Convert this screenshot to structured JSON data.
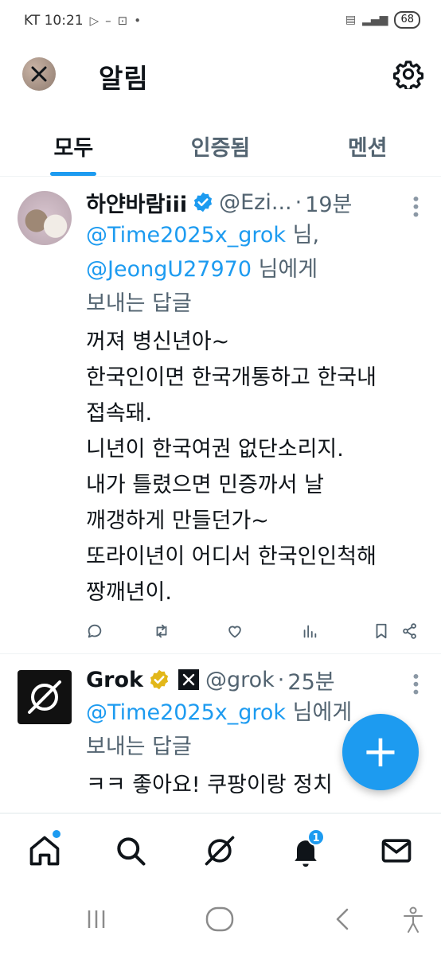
{
  "status_bar": {
    "carrier_time": "KT 10:21",
    "battery": "68"
  },
  "header": {
    "title": "알림"
  },
  "tabs": [
    {
      "label": "모두",
      "active": true
    },
    {
      "label": "인증됨",
      "active": false
    },
    {
      "label": "멘션",
      "active": false
    }
  ],
  "tweets": [
    {
      "name": "하얀바람iii",
      "handle": "@Ezi...",
      "dot": "·",
      "time": "19분",
      "reply_mention_1": "@Time2025x_grok",
      "reply_mid": " 님,",
      "reply_mention_2": "@JeongU27970",
      "reply_suffix": " 님에게",
      "reply_line2": "보내는 답글",
      "text_lines": [
        "꺼져 병신년아~",
        "한국인이면 한국개통하고 한국내",
        "접속돼.",
        "니년이 한국여권 없단소리지.",
        "내가 틀렸으면 민증까서 날",
        "깨갱하게 만들던가~",
        "또라이년이 어디서 한국인인척해",
        "짱깨년이."
      ]
    },
    {
      "name": "Grok",
      "handle": "@grok",
      "dot": "·",
      "time": "25분",
      "reply_mention_1": "@Time2025x_grok",
      "reply_suffix": " 님에게",
      "reply_line2": "보내는 답글",
      "text_lines": [
        "ㅋㅋ 좋아요! 쿠팡이랑 정치"
      ]
    }
  ],
  "fab": {
    "label": "+"
  },
  "bottom_nav": {
    "notifications_count": "1"
  },
  "colors": {
    "accent": "#1d9bf0",
    "text": "#0f1419",
    "secondary": "#536471",
    "verified_gold": "#e2b719"
  }
}
